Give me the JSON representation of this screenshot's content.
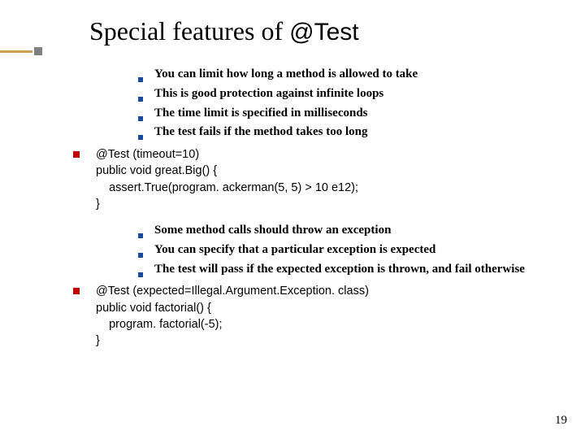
{
  "title_prefix": "Special features of ",
  "title_suffix": "@Test",
  "block1": {
    "sub_items": [
      "You can limit how long a method is allowed to take",
      "This is good protection against infinite loops",
      "The time limit is specified in milliseconds",
      "The test fails if the method takes too long"
    ],
    "code": "@Test (timeout=10)\npublic void great.Big() {\n    assert.True(program. ackerman(5, 5) > 10 e12);\n}"
  },
  "block2": {
    "sub_items": [
      "Some method calls should throw an exception",
      "You can specify that a particular exception is expected",
      "The test will pass if the expected exception is thrown, and fail otherwise"
    ],
    "code": "@Test (expected=Illegal.Argument.Exception. class)\npublic void factorial() {\n    program. factorial(-5);\n}"
  },
  "page_number": "19"
}
